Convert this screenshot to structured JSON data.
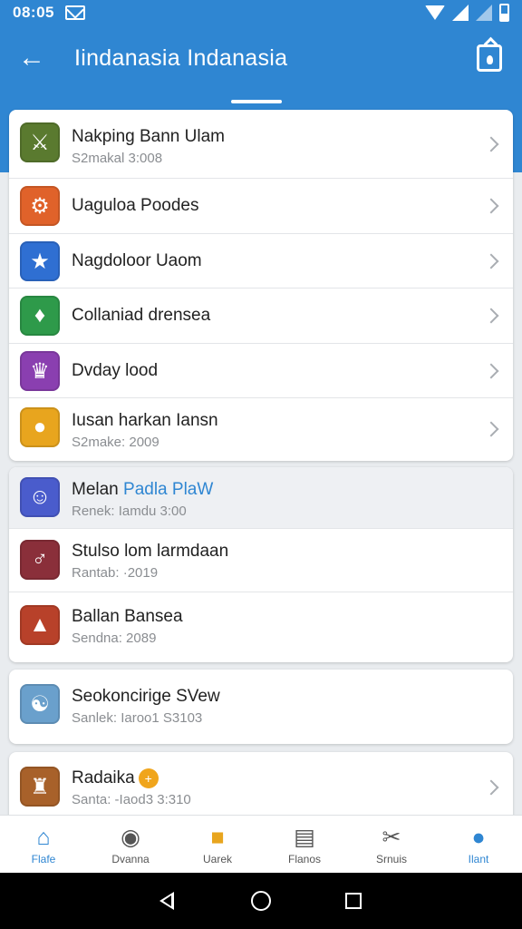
{
  "status_bar": {
    "time": "08:05"
  },
  "app_bar": {
    "title": "Iindanasia Indanasia"
  },
  "card1": [
    {
      "title": "Nakping Bann Ulam",
      "subtitle": "S2makal 3:008",
      "icon": "warrior-game-icon",
      "color": "#5a7a2f"
    },
    {
      "title": "Uagulоa Poodes",
      "subtitle": "",
      "icon": "shield-game-icon",
      "color": "#e0622a"
    },
    {
      "title": "Nagdoloor Uaom",
      "subtitle": "",
      "icon": "star-hero-game-icon",
      "color": "#2f6fd2"
    },
    {
      "title": "Collaniad drensea",
      "subtitle": "",
      "icon": "badge-game-icon",
      "color": "#2e9a4a"
    },
    {
      "title": "Dvday lood",
      "subtitle": "",
      "icon": "crest-game-icon",
      "color": "#8a3fb0"
    },
    {
      "title": "Iusan harkan Iansn",
      "subtitle": "S2make: 2009",
      "icon": "bird-game-icon",
      "color": "#e8a51e"
    }
  ],
  "card2": [
    {
      "title_main": "Melan ",
      "title_accent": "Padla PlaW",
      "subtitle": "Renek: Iamdu 3:00",
      "icon": "chat-app-icon",
      "color": "#4a5ccc"
    },
    {
      "title": "Stulso lom larmdaan",
      "subtitle": "Rantab: ·2019",
      "icon": "hero-game-icon",
      "color": "#8a2f3a"
    },
    {
      "title": "Ballan Bansea",
      "subtitle": "Sendna: 2089",
      "icon": "fox-game-icon",
      "color": "#b8412a"
    }
  ],
  "card3": [
    {
      "title": "Seokoncirige SVew",
      "subtitle": "Sanlek: Iaroo1 S3103",
      "icon": "girl-game-icon",
      "color": "#6aa0cc"
    }
  ],
  "card4": [
    {
      "title": "Radaika",
      "badge": "+",
      "subtitle": "Santa: -Iaod3 3:310",
      "icon": "cowboy-game-icon",
      "color": "#a8612a"
    }
  ],
  "bottom_nav": [
    {
      "label": "Flafe",
      "icon": "home-icon",
      "active": true
    },
    {
      "label": "Dvanna",
      "icon": "discover-icon",
      "active": false
    },
    {
      "label": "Uarek",
      "icon": "robot-icon",
      "active": false
    },
    {
      "label": "Flanos",
      "icon": "news-icon",
      "active": false
    },
    {
      "label": "Srnuis",
      "icon": "tools-icon",
      "active": false
    },
    {
      "label": "Ilant",
      "icon": "profile-icon",
      "active": true
    }
  ]
}
